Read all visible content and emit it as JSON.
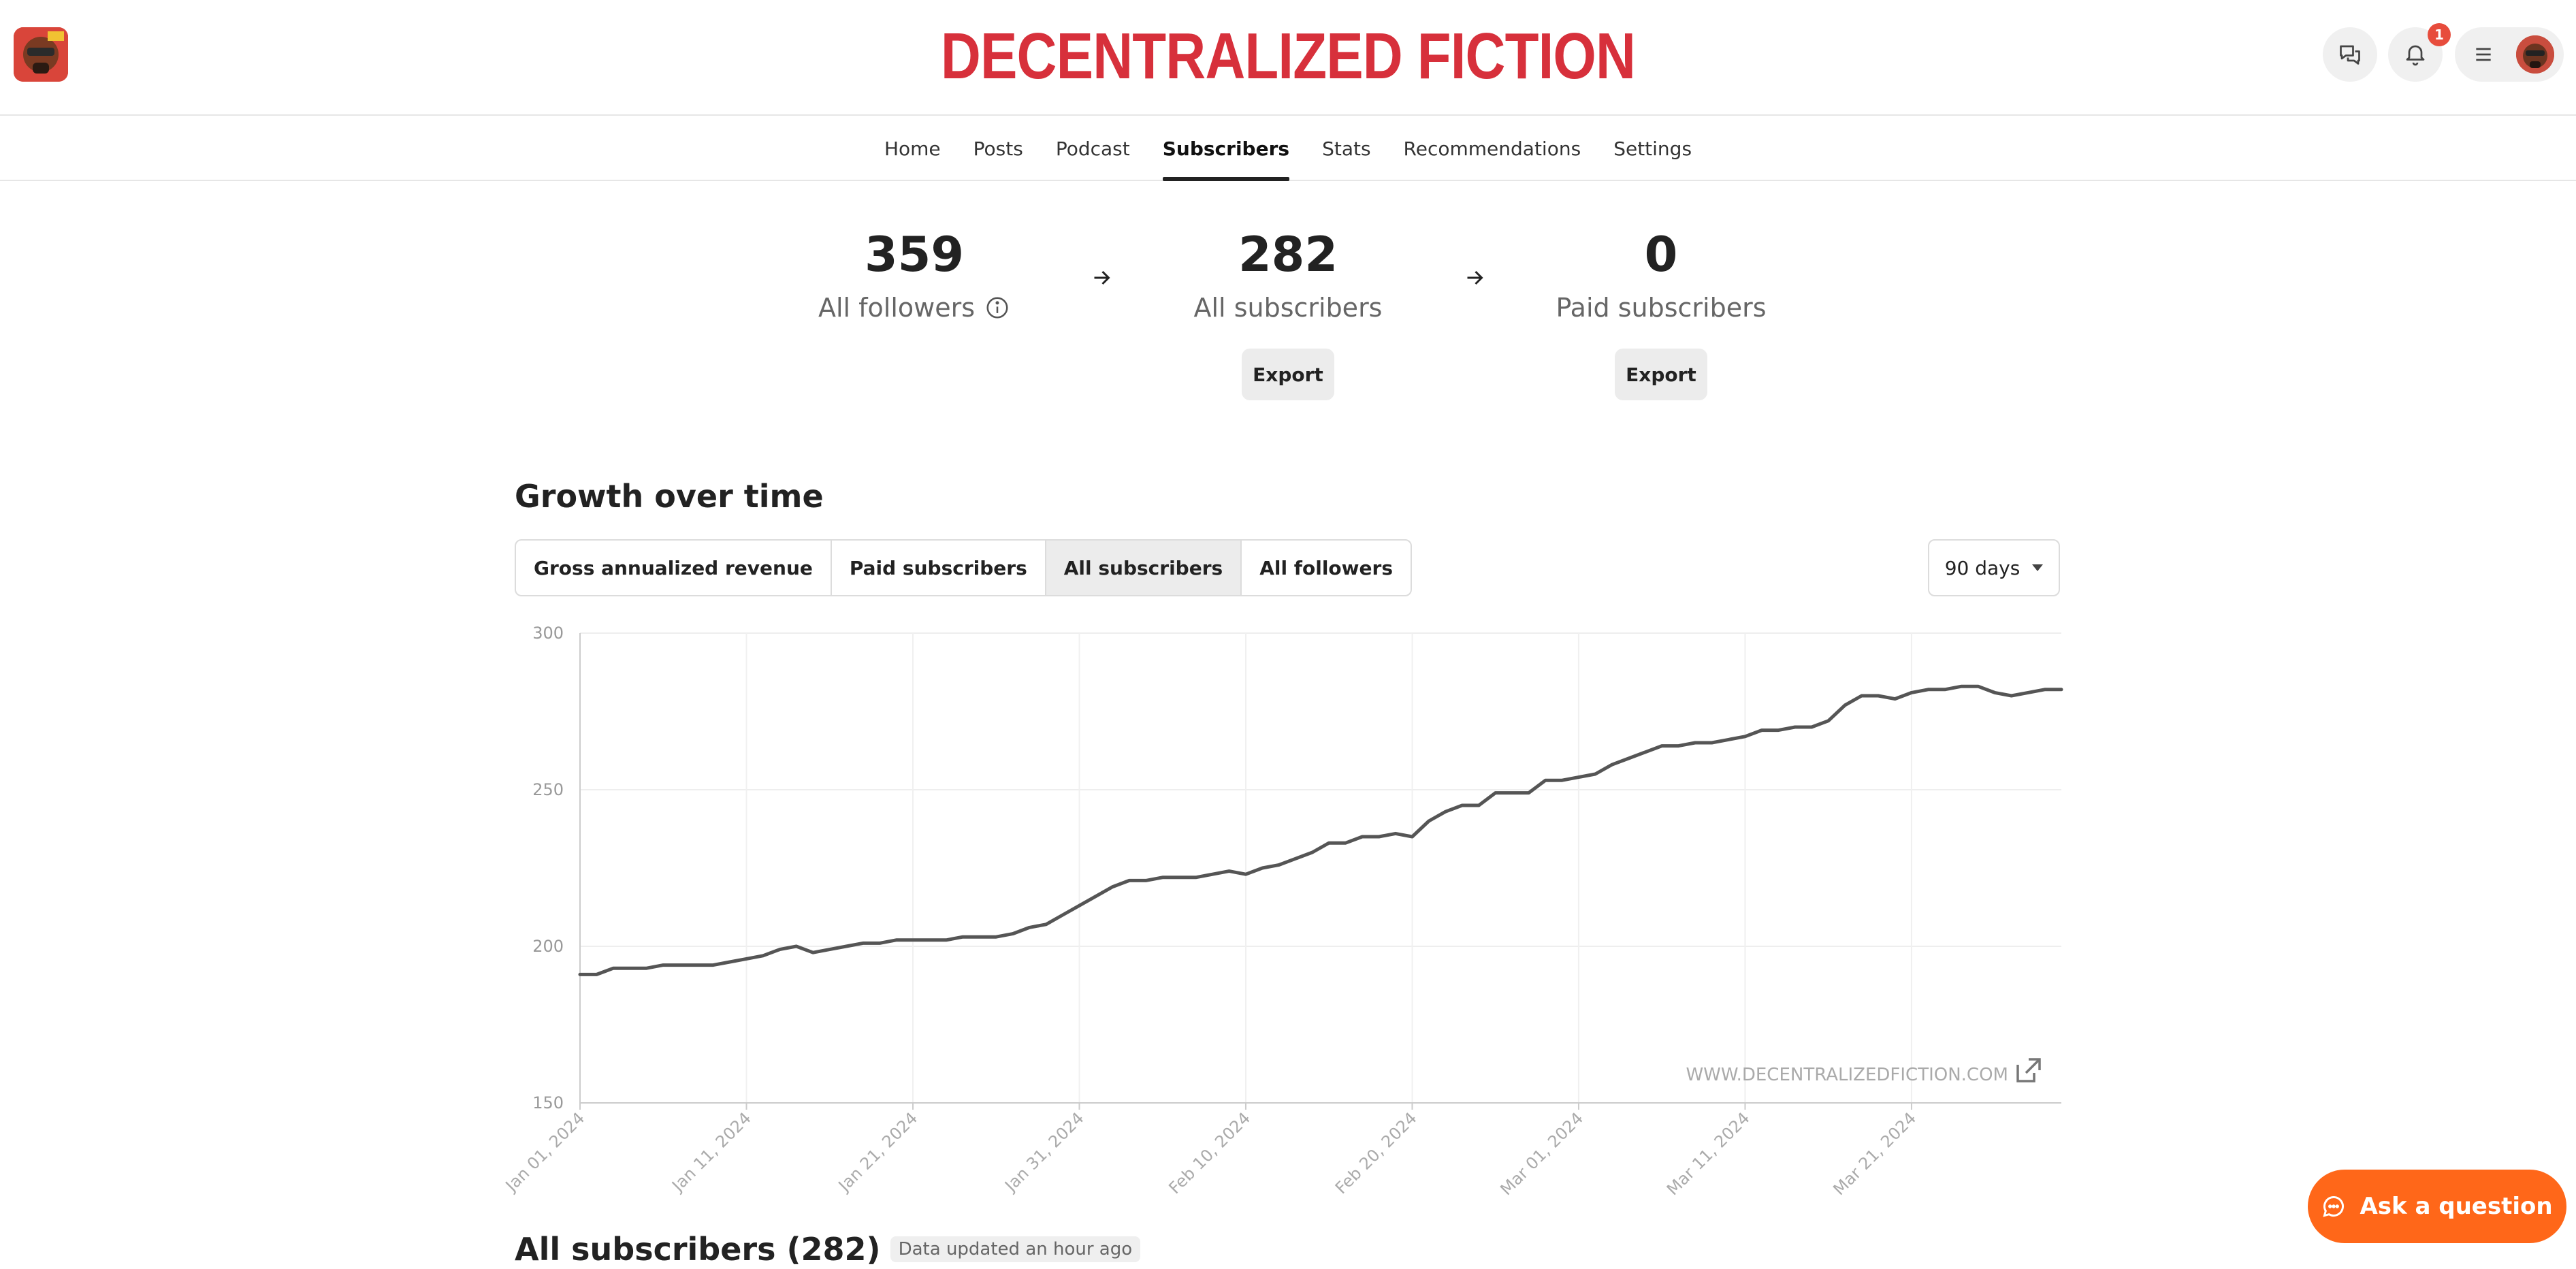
{
  "header": {
    "brand": "DECENTRALIZED FICTION",
    "notification_count": "1"
  },
  "nav": {
    "items": [
      "Home",
      "Posts",
      "Podcast",
      "Subscribers",
      "Stats",
      "Recommendations",
      "Settings"
    ],
    "active": "Subscribers"
  },
  "stats": {
    "followers": {
      "value": "359",
      "label": "All followers"
    },
    "subscribers": {
      "value": "282",
      "label": "All subscribers",
      "export": "Export"
    },
    "paid": {
      "value": "0",
      "label": "Paid subscribers",
      "export": "Export"
    }
  },
  "growth": {
    "title": "Growth over time",
    "tabs": [
      "Gross annualized revenue",
      "Paid subscribers",
      "All subscribers",
      "All followers"
    ],
    "active_tab": "All subscribers",
    "range": "90 days"
  },
  "chart_data": {
    "type": "line",
    "xlabel": "",
    "ylabel": "",
    "ylim": [
      150,
      300
    ],
    "yticks": [
      "300",
      "250",
      "200",
      "150"
    ],
    "xticks": [
      "Jan 01, 2024",
      "Jan 11, 2024",
      "Jan 21, 2024",
      "Jan 31, 2024",
      "Feb 10, 2024",
      "Feb 20, 2024",
      "Mar 01, 2024",
      "Mar 11, 2024",
      "Mar 21, 2024"
    ],
    "grid": true,
    "watermark": "WWW.DECENTRALIZEDFICTION.COM",
    "x_start": "2024-01-01",
    "values": [
      191,
      191,
      193,
      193,
      193,
      194,
      194,
      194,
      194,
      195,
      196,
      197,
      199,
      200,
      198,
      199,
      200,
      201,
      201,
      202,
      202,
      202,
      202,
      203,
      203,
      203,
      204,
      206,
      207,
      210,
      213,
      216,
      219,
      221,
      221,
      222,
      222,
      222,
      223,
      224,
      223,
      225,
      226,
      228,
      230,
      233,
      233,
      235,
      235,
      236,
      235,
      240,
      243,
      245,
      245,
      249,
      249,
      249,
      253,
      253,
      254,
      255,
      258,
      260,
      262,
      264,
      264,
      265,
      265,
      266,
      267,
      269,
      269,
      270,
      270,
      272,
      277,
      280,
      280,
      279,
      281,
      282,
      282,
      283,
      283,
      281,
      280,
      281,
      282,
      282
    ]
  },
  "list": {
    "title": "All subscribers (282)",
    "updated": "Data updated an hour ago"
  },
  "help": {
    "ask": "Ask a question"
  },
  "colors": {
    "brand": "#d7303b",
    "ask": "#ff6719",
    "line": "#555555"
  }
}
